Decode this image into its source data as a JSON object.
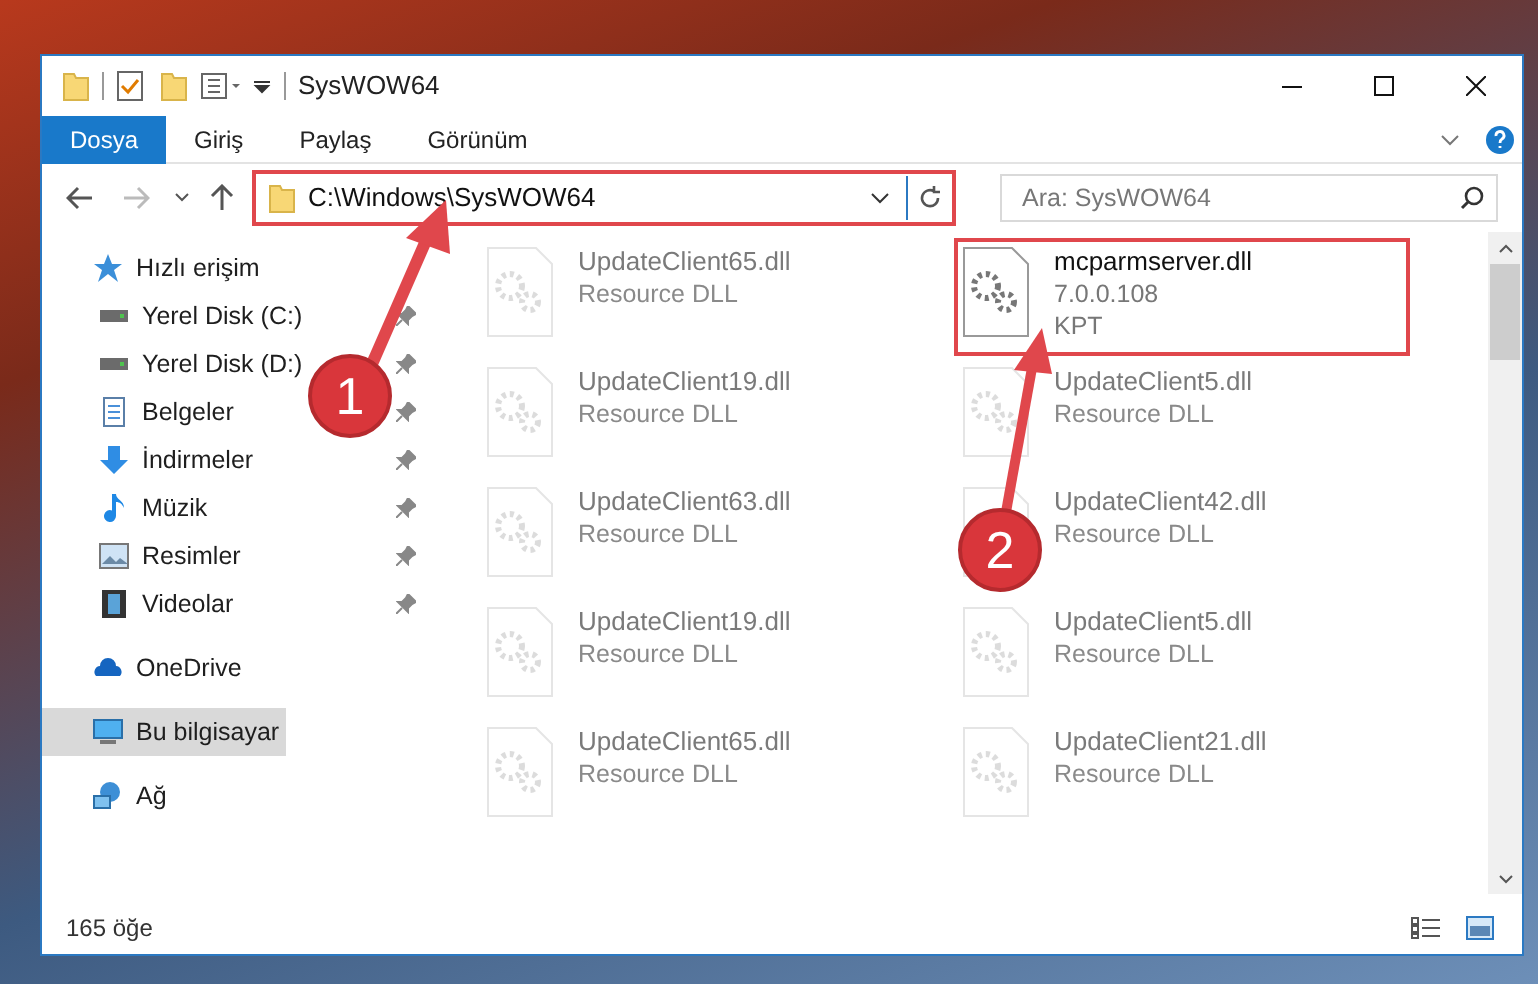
{
  "window": {
    "title": "SysWOW64"
  },
  "ribbon_tabs": [
    {
      "label": "Dosya",
      "selected": true
    },
    {
      "label": "Giriş",
      "selected": false
    },
    {
      "label": "Paylaş",
      "selected": false
    },
    {
      "label": "Görünüm",
      "selected": false
    }
  ],
  "address": {
    "path": "C:\\Windows\\SysWOW64",
    "highlighted": true
  },
  "search": {
    "placeholder": "Ara: SysWOW64"
  },
  "navigation": [
    {
      "label": "Hızlı erişim",
      "kind": "star",
      "selected": false,
      "children": [
        {
          "label": "Yerel Disk (C:)",
          "kind": "drive",
          "pinned": true,
          "selected": false
        },
        {
          "label": "Yerel Disk (D:)",
          "kind": "drive",
          "pinned": true,
          "selected": false
        },
        {
          "label": "Belgeler",
          "kind": "document",
          "pinned": true,
          "selected": false
        },
        {
          "label": "İndirmeler",
          "kind": "download",
          "pinned": true,
          "selected": false
        },
        {
          "label": "Müzik",
          "kind": "music",
          "pinned": true,
          "selected": false
        },
        {
          "label": "Resimler",
          "kind": "picture",
          "pinned": true,
          "selected": false
        },
        {
          "label": "Videolar",
          "kind": "film",
          "pinned": true,
          "selected": false
        }
      ]
    },
    {
      "label": "OneDrive",
      "kind": "cloud",
      "selected": false
    },
    {
      "label": "Bu bilgisayar",
      "kind": "computer",
      "selected": true
    },
    {
      "label": "Ağ",
      "kind": "network",
      "selected": false
    }
  ],
  "files": [
    {
      "name": "UpdateClient65.dll",
      "details": [
        "Resource DLL"
      ],
      "faded": true
    },
    {
      "name": "mcparmserver.dll",
      "details": [
        "7.0.0.108",
        "KPT"
      ],
      "faded": false,
      "highlighted": true
    },
    {
      "name": "UpdateClient19.dll",
      "details": [
        "Resource DLL"
      ],
      "faded": true
    },
    {
      "name": "UpdateClient5.dll",
      "details": [
        "Resource DLL"
      ],
      "faded": true
    },
    {
      "name": "UpdateClient63.dll",
      "details": [
        "Resource DLL"
      ],
      "faded": true
    },
    {
      "name": "UpdateClient42.dll",
      "details": [
        "Resource DLL"
      ],
      "faded": true
    },
    {
      "name": "UpdateClient19.dll",
      "details": [
        "Resource DLL"
      ],
      "faded": true
    },
    {
      "name": "UpdateClient5.dll",
      "details": [
        "Resource DLL"
      ],
      "faded": true
    },
    {
      "name": "UpdateClient65.dll",
      "details": [
        "Resource DLL"
      ],
      "faded": true
    },
    {
      "name": "UpdateClient21.dll",
      "details": [
        "Resource DLL"
      ],
      "faded": true
    }
  ],
  "status_bar": {
    "item_count": "165 öğe"
  },
  "callouts": [
    {
      "label": "1"
    },
    {
      "label": "2"
    }
  ]
}
